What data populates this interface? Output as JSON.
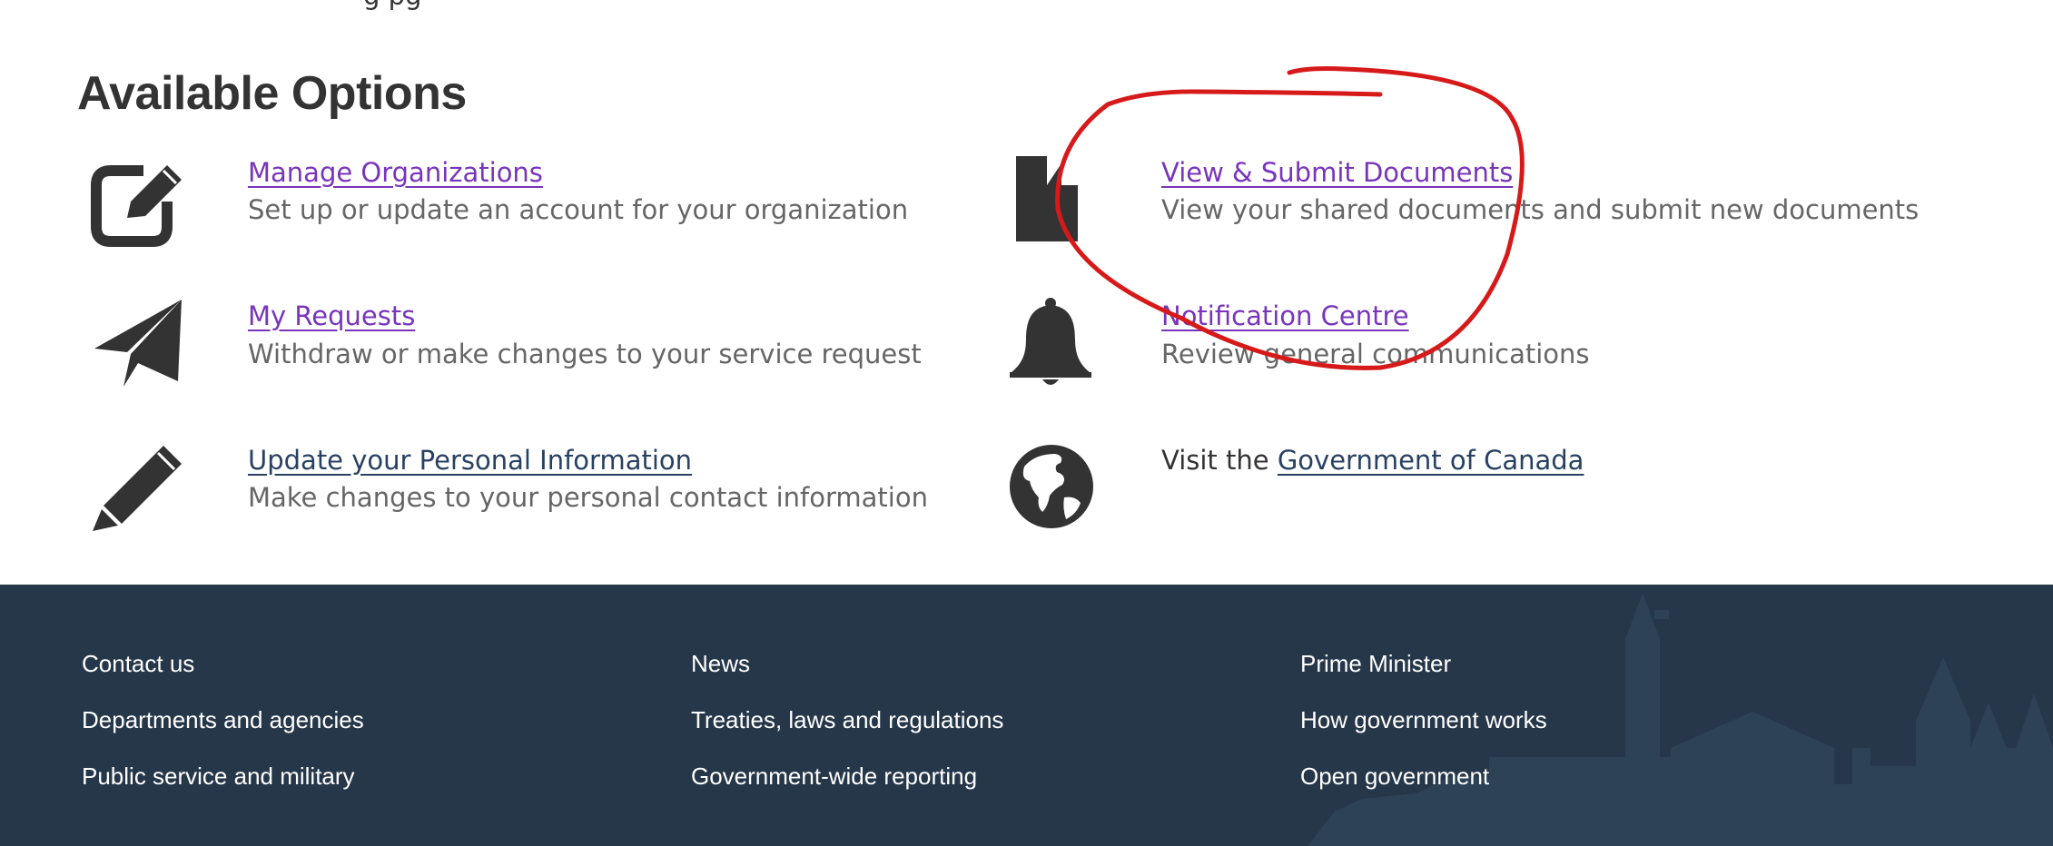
{
  "top_cut_text": "g  pg",
  "heading": "Available Options",
  "options": [
    {
      "title": "Manage Organizations",
      "description": "Set up or update an account for your organization",
      "icon": "edit-icon"
    },
    {
      "title": "View & Submit Documents",
      "description": "View your shared documents and submit new documents",
      "icon": "document-icon"
    },
    {
      "title": "My Requests",
      "description": "Withdraw or make changes to your service request",
      "icon": "send-icon"
    },
    {
      "title": "Notification Centre",
      "description": "Review general communications",
      "icon": "bell-icon"
    },
    {
      "title": "Update your Personal Information",
      "description": "Make changes to your personal contact information",
      "icon": "pencil-icon"
    }
  ],
  "visit": {
    "prefix": "Visit the",
    "link": "Government of Canada",
    "icon": "globe-icon"
  },
  "footer": {
    "col1": [
      "Contact us",
      "Departments and agencies",
      "Public service and military"
    ],
    "col2": [
      "News",
      "Treaties, laws and regulations",
      "Government-wide reporting"
    ],
    "col3": [
      "Prime Minister",
      "How government works",
      "Open government"
    ]
  },
  "colors": {
    "link": "#7834bc",
    "link_dark": "#284162",
    "footer_bg": "#26374a",
    "annotation": "#d61a1a"
  }
}
